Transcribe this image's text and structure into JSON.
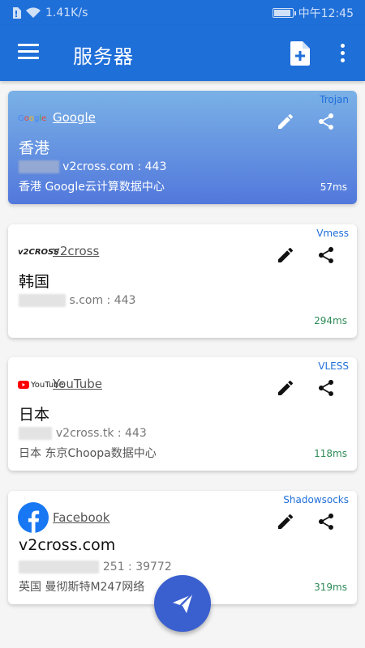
{
  "status": {
    "speed": "1.41K/s",
    "time": "中午12:45",
    "battery_level": 0.85
  },
  "app": {
    "title": "服务器"
  },
  "cards": [
    {
      "protocol": "Trojan",
      "provider": "Google",
      "name": "香港",
      "address": "v2cross.com : 443",
      "location": "香港   Google云计算数据中心",
      "latency": "57ms"
    },
    {
      "protocol": "Vmess",
      "provider": "v2cross",
      "name": "韩国",
      "address": "s.com : 443",
      "location": "",
      "latency": "294ms"
    },
    {
      "protocol": "VLESS",
      "provider": "YouTube",
      "name": "日本",
      "address": "v2cross.tk : 443",
      "location": "日本   东京Choopa数据中心",
      "latency": "118ms"
    },
    {
      "protocol": "Shadowsocks",
      "provider": "Facebook",
      "name": "v2cross.com",
      "address": "251 : 39772",
      "location": "英国   曼彻斯特M247网络",
      "latency": "319ms"
    }
  ],
  "logos": {
    "google": "Google",
    "v2cross": "v2CROSS",
    "youtube": "YouTube"
  }
}
